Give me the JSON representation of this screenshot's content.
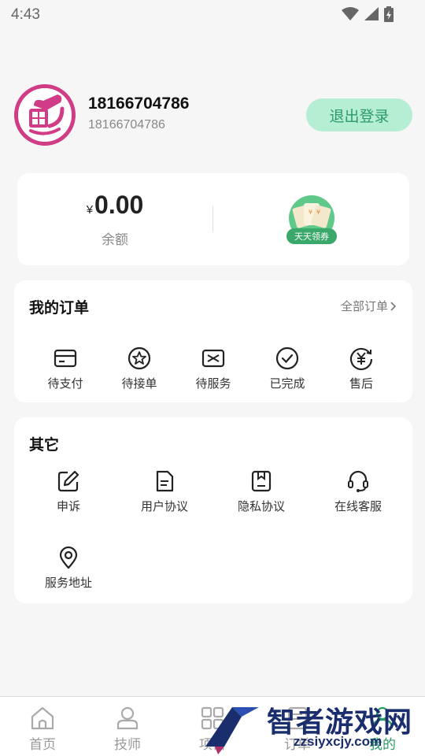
{
  "status_bar": {
    "time": "4:43",
    "icons": [
      "wifi-icon",
      "signal-icon",
      "battery-icon"
    ]
  },
  "profile": {
    "name": "18166704786",
    "phone": "18166704786",
    "logout_label": "退出登录"
  },
  "balance": {
    "currency": "¥",
    "amount": "0.00",
    "label": "余额",
    "coupon_label": "天天领券"
  },
  "orders": {
    "title": "我的订单",
    "all_label": "全部订单",
    "items": [
      {
        "label": "待支付",
        "icon": "card-icon"
      },
      {
        "label": "待接单",
        "icon": "star-badge-icon"
      },
      {
        "label": "待服务",
        "icon": "ticket-icon"
      },
      {
        "label": "已完成",
        "icon": "check-circle-icon"
      },
      {
        "label": "售后",
        "icon": "yen-refresh-icon"
      }
    ]
  },
  "other": {
    "title": "其它",
    "items": [
      {
        "label": "申诉",
        "icon": "edit-icon"
      },
      {
        "label": "用户协议",
        "icon": "document-icon"
      },
      {
        "label": "隐私协议",
        "icon": "privacy-icon"
      },
      {
        "label": "在线客服",
        "icon": "headset-icon"
      },
      {
        "label": "服务地址",
        "icon": "location-icon"
      }
    ]
  },
  "nav": {
    "items": [
      {
        "label": "首页",
        "icon": "home-icon"
      },
      {
        "label": "技师",
        "icon": "technician-icon"
      },
      {
        "label": "项目",
        "icon": "grid-icon"
      },
      {
        "label": "订单",
        "icon": "order-icon"
      },
      {
        "label": "我的",
        "icon": "profile-icon"
      }
    ]
  },
  "watermark": {
    "text": "智者游戏网",
    "url": "zzsiyxcjy.com"
  },
  "colors": {
    "accent": "#2b9a68",
    "logout_bg": "#b6eed3",
    "avatar_border": "#d03c86",
    "coupon": "#3aa86a"
  }
}
